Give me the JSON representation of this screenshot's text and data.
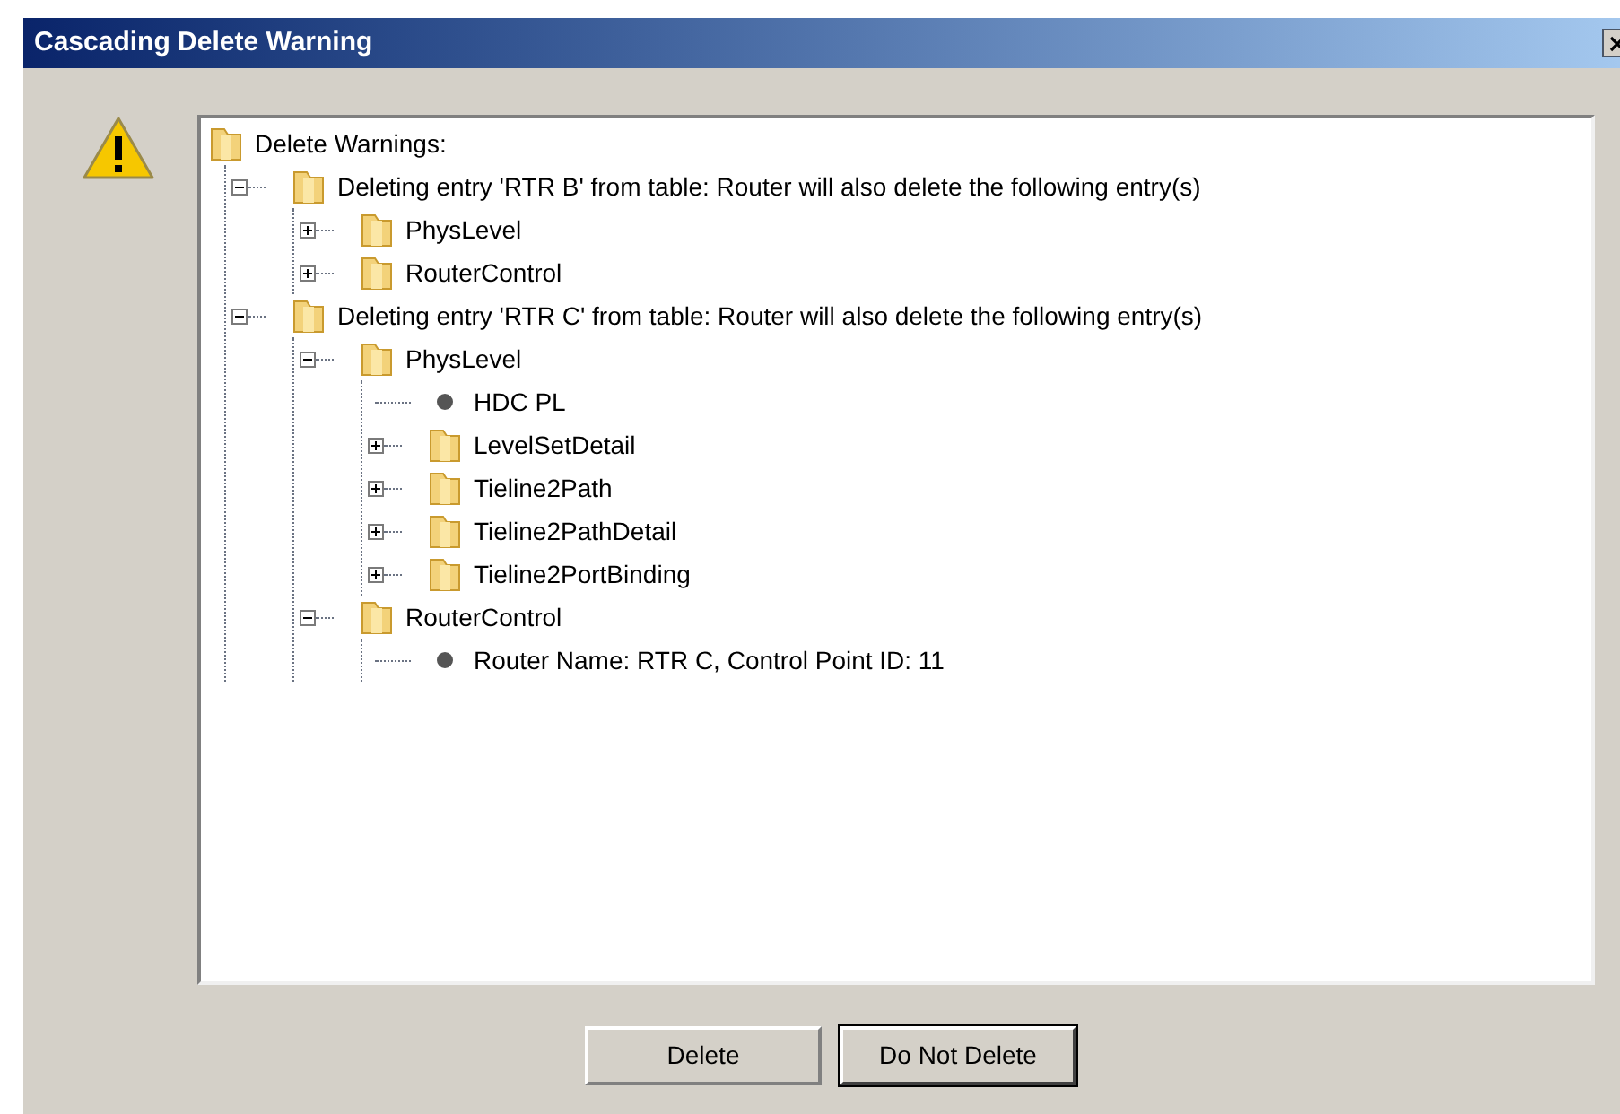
{
  "window": {
    "title": "Cascading Delete Warning"
  },
  "tree": [
    {
      "kind": "root",
      "label": "Delete Warnings:",
      "children": [
        {
          "kind": "folder",
          "label": "Deleting entry 'RTR B' from table: Router will also delete the following entry(s)",
          "expanded": true,
          "children": [
            {
              "kind": "folder",
              "label": "PhysLevel",
              "expanded": false
            },
            {
              "kind": "folder",
              "label": "RouterControl",
              "expanded": false
            }
          ]
        },
        {
          "kind": "folder",
          "label": "Deleting entry 'RTR C' from table: Router will also delete the following entry(s)",
          "expanded": true,
          "children": [
            {
              "kind": "folder",
              "label": "PhysLevel",
              "expanded": true,
              "children": [
                {
                  "kind": "leaf",
                  "label": "HDC PL"
                },
                {
                  "kind": "folder",
                  "label": "LevelSetDetail",
                  "expanded": false
                },
                {
                  "kind": "folder",
                  "label": "Tieline2Path",
                  "expanded": false
                },
                {
                  "kind": "folder",
                  "label": "Tieline2PathDetail",
                  "expanded": false
                },
                {
                  "kind": "folder",
                  "label": "Tieline2PortBinding",
                  "expanded": false
                }
              ]
            },
            {
              "kind": "folder",
              "label": "RouterControl",
              "expanded": true,
              "children": [
                {
                  "kind": "leaf",
                  "label": "Router Name: RTR C, Control Point ID: 11"
                }
              ]
            }
          ]
        }
      ]
    }
  ],
  "buttons": [
    {
      "label": "Delete",
      "default": false
    },
    {
      "label": "Do Not Delete",
      "default": true
    }
  ]
}
